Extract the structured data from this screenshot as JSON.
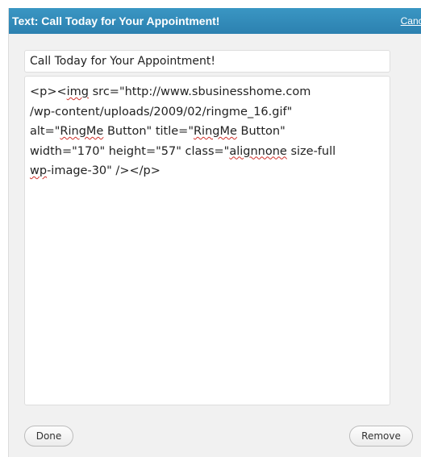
{
  "widget": {
    "title": "Text: Call Today for Your Appointment!",
    "cancel_label": "Cancel"
  },
  "form": {
    "title_value": "Call Today for Your Appointment!",
    "content_lines": [
      "<p><img src=\"http://www.sbusinesshome.com",
      "/wp-content/uploads/2009/02/ringme_16.gif\"",
      "alt=\"RingMe Button\" title=\"RingMe Button\"",
      "width=\"170\" height=\"57\" class=\"alignnone size-full",
      "wp-image-30\" /></p>"
    ]
  },
  "buttons": {
    "done_label": "Done",
    "remove_label": "Remove"
  }
}
